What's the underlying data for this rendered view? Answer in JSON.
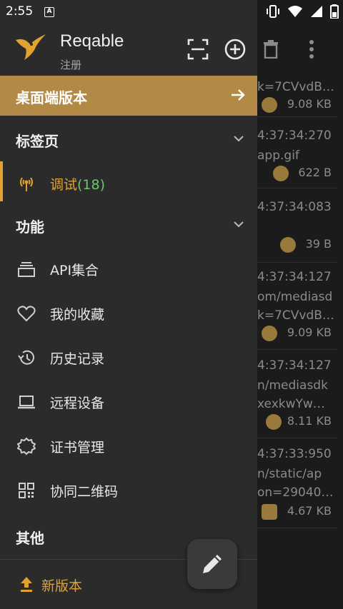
{
  "status_bar": {
    "time": "2:55",
    "notification_letter": "A"
  },
  "header": {
    "app_name": "Reqable",
    "subtitle": "注册"
  },
  "banner": {
    "label": "桌面端版本"
  },
  "sections": {
    "tabs": "标签页",
    "features": "功能",
    "others": "其他"
  },
  "active_tab": {
    "label": "调试",
    "count": "(18)"
  },
  "menu": [
    {
      "label": "API集合"
    },
    {
      "label": "我的收藏"
    },
    {
      "label": "历史记录"
    },
    {
      "label": "远程设备"
    },
    {
      "label": "证书管理"
    },
    {
      "label": "协同二维码"
    }
  ],
  "update": {
    "label": "新版本"
  },
  "background_rows": [
    {
      "line1": "k=7CVvdB…",
      "size": "9.08 KB"
    },
    {
      "line1": "4:37:34:270",
      "line2": "app.gif",
      "size": "622 B"
    },
    {
      "line1": "4:37:34:083",
      "size": "39 B"
    },
    {
      "line1": "4:37:34:127",
      "line2": "om/mediasd",
      "line3": "k=7CVvdB…",
      "size": "9.09 KB"
    },
    {
      "line1": "4:37:34:127",
      "line2": "n/mediasdk",
      "line3": "xexkwYw…",
      "size": "8.11 KB"
    },
    {
      "line1": "4:37:33:950",
      "line2": "n/static/ap",
      "line3": "on=29040…",
      "size": "4.67 KB"
    }
  ],
  "colors": {
    "accent": "#b38a45",
    "active": "#e2a230",
    "count": "#6cc46c",
    "drawer_bg": "#2b2b2b"
  }
}
